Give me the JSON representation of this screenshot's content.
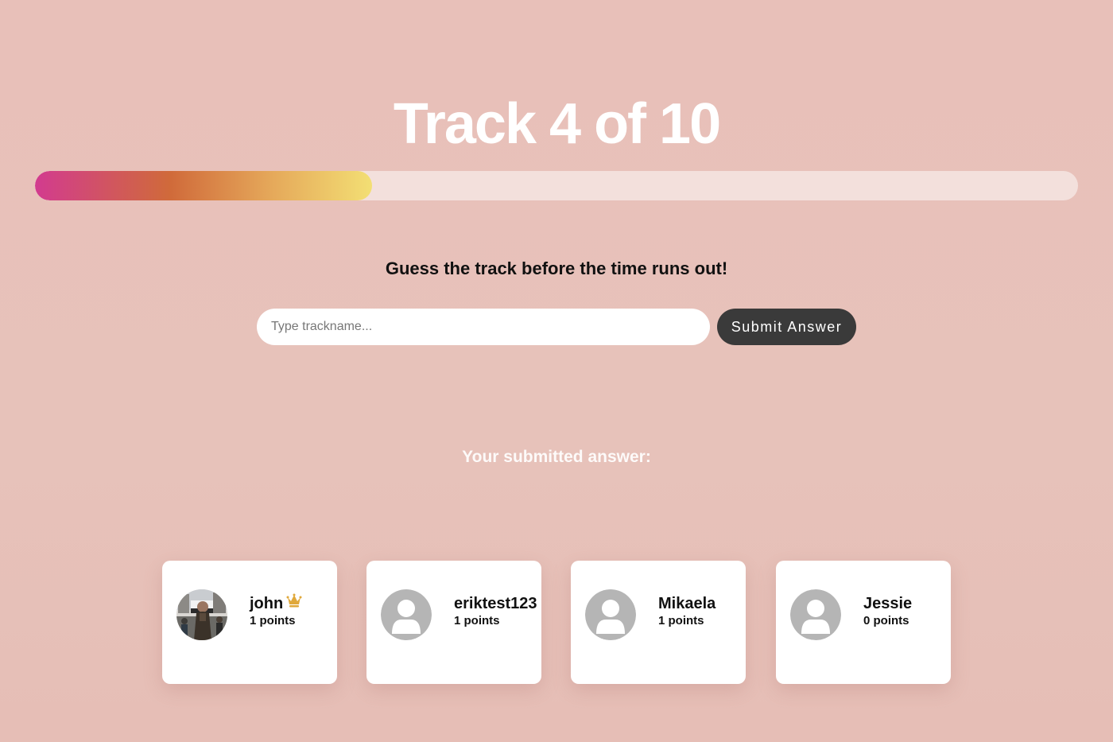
{
  "header": {
    "title": "Track 4 of 10"
  },
  "progress": {
    "current": 4,
    "total": 10,
    "fraction": 0.323,
    "colors": [
      "#d23b8f",
      "#d06a3a",
      "#e5a85a",
      "#f3df74"
    ]
  },
  "game": {
    "instruction": "Guess the track before the time runs out!",
    "input_placeholder": "Type trackname...",
    "input_value": "",
    "submit_label": "Submit Answer",
    "submitted_label": "Your submitted answer:"
  },
  "players": [
    {
      "name": "john",
      "points": "1 points",
      "avatar": "photo-avatar",
      "leader": true,
      "leader_icon": "crown-icon"
    },
    {
      "name": "eriktest123",
      "points": "1 points",
      "avatar": "default-user-avatar",
      "leader": false
    },
    {
      "name": "Mikaela",
      "points": "1 points",
      "avatar": "default-user-avatar",
      "leader": false
    },
    {
      "name": "Jessie",
      "points": "0 points",
      "avatar": "default-user-avatar",
      "leader": false
    }
  ],
  "colors": {
    "background": "#e7c2ba",
    "button": "#3a3a3a",
    "crown": "#e0a83a",
    "avatar_placeholder": "#b5b5b5"
  }
}
